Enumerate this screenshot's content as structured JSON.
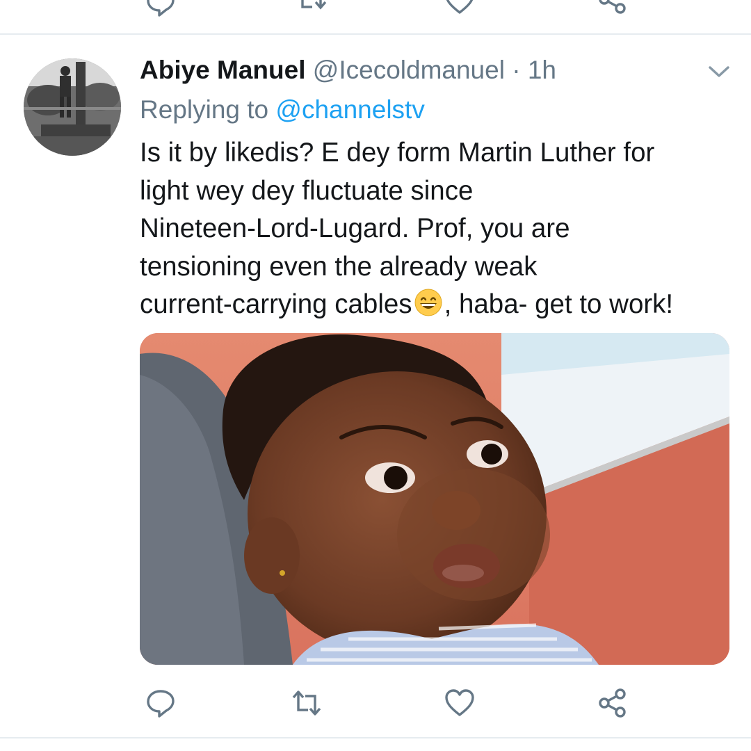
{
  "tweet": {
    "display_name": "Abiye Manuel",
    "handle": "@Icecoldmanuel",
    "separator": "·",
    "time": "1h",
    "replying_prefix": "Replying to ",
    "replying_to": "@channelstv",
    "text_lines": [
      "Is it by likedis? E dey form Martin Luther for",
      "light wey dey fluctuate since",
      "Nineteen-Lord-Lugard. Prof,  you are",
      "tensioning even the already weak"
    ],
    "last_line_before_emoji": "current-carrying cables",
    "last_line_after_emoji": ", haba- get to work!",
    "emoji": "grinning-face-with-smiling-eyes"
  },
  "icons": {
    "reply": "reply-icon",
    "retweet": "retweet-icon",
    "like": "heart-icon",
    "share": "share-icon",
    "menu": "chevron-down-icon"
  },
  "colors": {
    "icon_gray": "#657786",
    "mention_blue": "#1da1f2",
    "divider": "#e6ecf0"
  }
}
